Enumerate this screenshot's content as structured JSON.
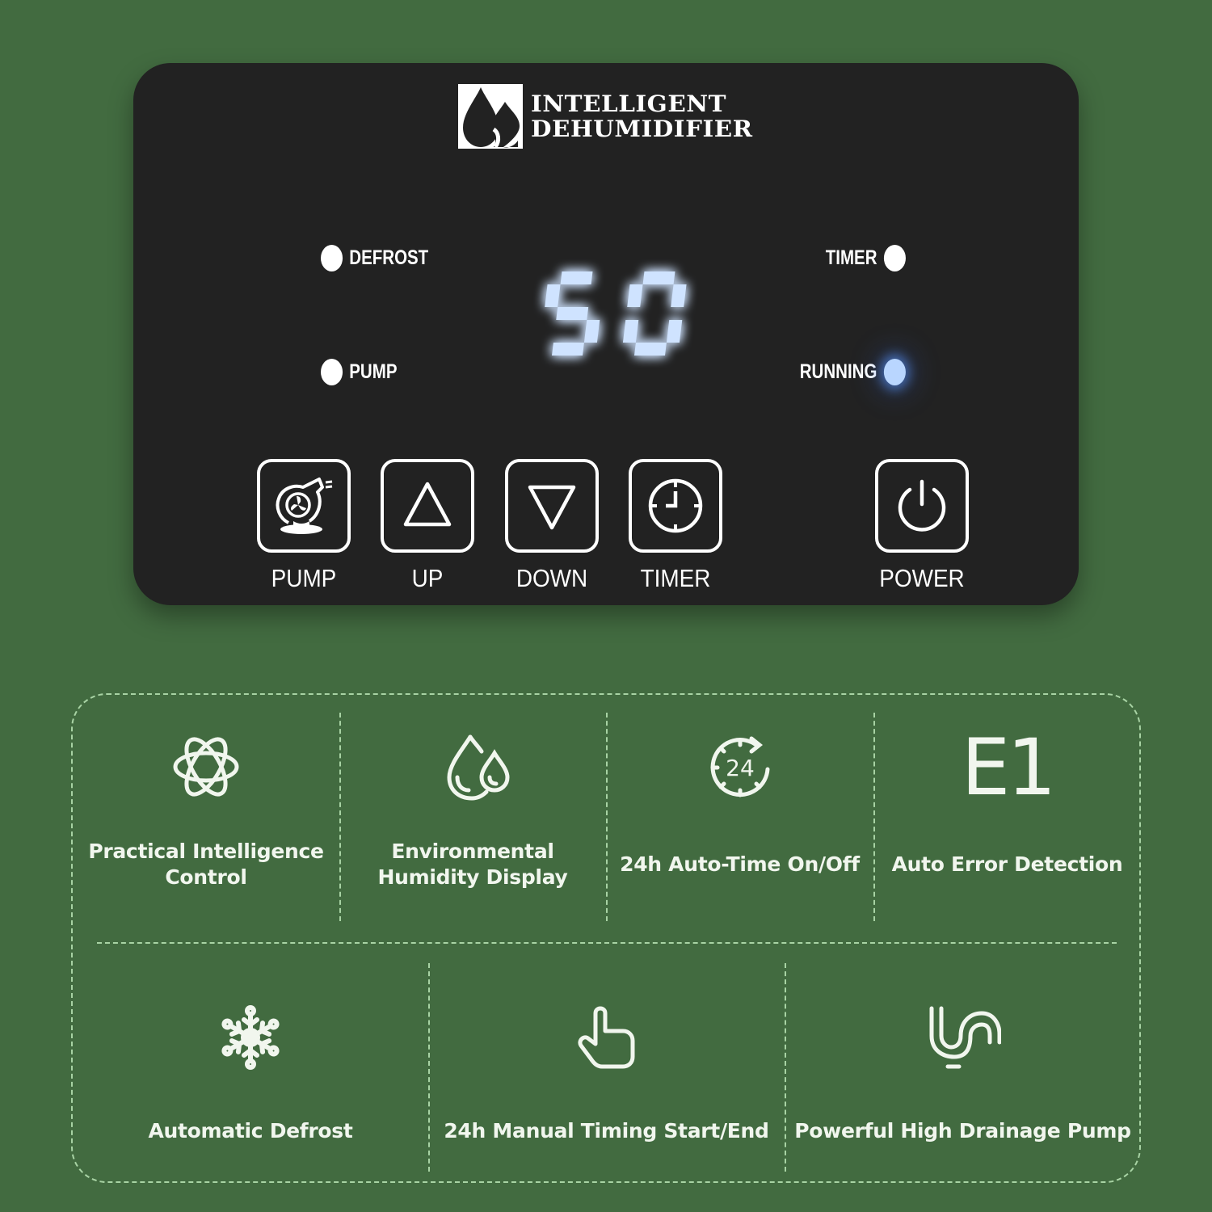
{
  "panel": {
    "brand": {
      "logo_icon": "water-drops-icon",
      "line1": "INTELLIGENT",
      "line2": "DEHUMIDIFIER"
    },
    "indicators": [
      {
        "label": "DEFROST",
        "state": "off"
      },
      {
        "label": "PUMP",
        "state": "off"
      },
      {
        "label": "TIMER",
        "state": "off"
      },
      {
        "label": "RUNNING",
        "state": "on"
      }
    ],
    "display": {
      "value": "50",
      "color": "#cfe3ff",
      "glow": "#3a78ff"
    },
    "buttons": [
      {
        "label": "PUMP",
        "icon": "pump-fan-icon"
      },
      {
        "label": "UP",
        "icon": "triangle-up-icon"
      },
      {
        "label": "DOWN",
        "icon": "triangle-down-icon"
      },
      {
        "label": "TIMER",
        "icon": "clock-icon"
      },
      {
        "label": "POWER",
        "icon": "power-icon"
      }
    ]
  },
  "features": {
    "row1": [
      {
        "icon": "atom-icon",
        "line1": "Practical Intelligence",
        "line2": "Control"
      },
      {
        "icon": "water-drops-icon",
        "line1": "Environmental",
        "line2": "Humidity Display"
      },
      {
        "icon": "clock-24-icon",
        "line1": "24h Auto-Time On/Off",
        "line2": ""
      },
      {
        "icon": "e1-error-icon",
        "icon_text": "E1",
        "line1": "Auto Error Detection",
        "line2": ""
      }
    ],
    "row2": [
      {
        "icon": "snowflake-icon",
        "line1": "Automatic Defrost"
      },
      {
        "icon": "pointing-hand-icon",
        "line1": "24h Manual Timing Start/End"
      },
      {
        "icon": "drain-pipe-icon",
        "line1": "Powerful High Drainage Pump"
      }
    ]
  },
  "colors": {
    "background": "#426b40",
    "panel": "#222222",
    "dashed_border": "#a8d3a4",
    "text_light": "#f1f6ee"
  }
}
